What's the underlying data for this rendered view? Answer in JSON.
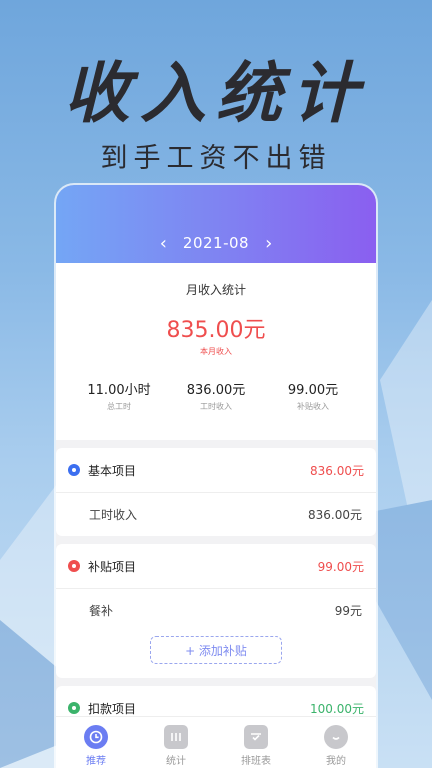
{
  "hero": {
    "title": "收入统计",
    "subtitle": "到手工资不出错"
  },
  "header": {
    "month": "2021-08",
    "prev_icon": "chevron-left-icon",
    "next_icon": "chevron-right-icon"
  },
  "summary": {
    "title": "月收入统计",
    "amount": "835.00元",
    "amount_label": "本月收入",
    "stats": [
      {
        "value": "11.00小时",
        "label": "总工时"
      },
      {
        "value": "836.00元",
        "label": "工时收入"
      },
      {
        "value": "99.00元",
        "label": "补贴收入"
      }
    ]
  },
  "basic": {
    "title": "基本项目",
    "total": "836.00元",
    "color": "#3c6ff0",
    "rows": [
      {
        "name": "工时收入",
        "value": "836.00元"
      }
    ]
  },
  "subsidy": {
    "title": "补贴项目",
    "total": "99.00元",
    "color": "#ef4e4e",
    "rows": [
      {
        "name": "餐补",
        "value": "99元"
      }
    ],
    "add_label": "+ 添加补贴"
  },
  "deduct": {
    "title": "扣款项目",
    "total": "100.00元",
    "color": "#3bb36b"
  },
  "tabs": [
    {
      "label": "推荐",
      "icon": "clock-icon",
      "active": true
    },
    {
      "label": "统计",
      "icon": "chart-icon",
      "active": false
    },
    {
      "label": "排班表",
      "icon": "calendar-check-icon",
      "active": false
    },
    {
      "label": "我的",
      "icon": "smile-icon",
      "active": false
    }
  ],
  "colors": {
    "accent": "#6b7df2",
    "income": "#ef4e4e"
  }
}
